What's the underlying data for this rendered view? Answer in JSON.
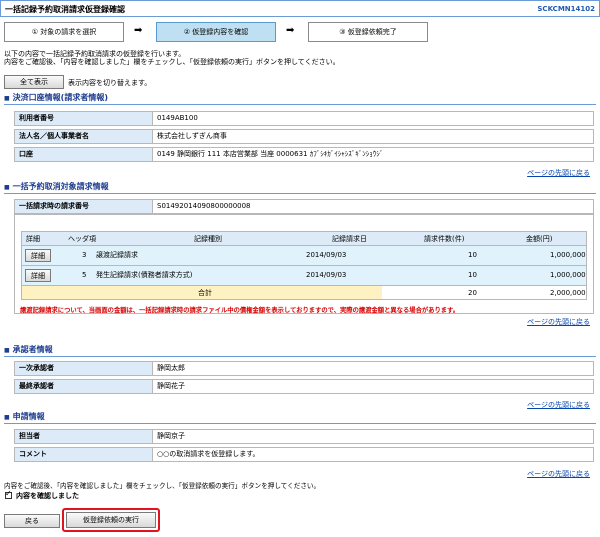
{
  "header": {
    "title": "一括記録予約取消請求仮登録確認",
    "screen_code": "SCKCMN14102"
  },
  "steps": [
    {
      "label": "① 対象の請求を選択"
    },
    {
      "label": "② 仮登録内容を確認"
    },
    {
      "label": "③ 仮登録依頼完了"
    }
  ],
  "intro": {
    "line1": "以下の内容で一括記録予約取消請求の仮登録を行います。",
    "line2": "内容をご確認後、「内容を確認しました」欄をチェックし、「仮登録依頼の実行」ボタンを押してください。"
  },
  "toggle": {
    "button": "全て表示",
    "text": "表示内容を切り替えます。"
  },
  "settlement": {
    "title": "決済口座情報(請求者情報)",
    "rows": [
      {
        "label": "利用者番号",
        "value": "0149AB100"
      },
      {
        "label": "法人名／個人事業者名",
        "value": "株式会社しずぎん商事"
      },
      {
        "label": "口座",
        "value": "0149 静岡銀行 111 本店営業部 当座 0000631 ｶﾌﾞｼｷｶﾞｲｼｬｼｽﾞｷﾞﾝｼｮｳｼﾞ"
      }
    ]
  },
  "page_top": "ページの先頭に戻る",
  "cancel_info": {
    "title": "一括予約取消対象請求情報",
    "request_label": "一括請求時の請求番号",
    "request_value": "S01492014090800000008",
    "columns": [
      "詳細",
      "ヘッダ項",
      "記録種別",
      "記録請求日",
      "請求件数(件)",
      "金額(円)"
    ],
    "rows": [
      {
        "detail": "詳細",
        "header": "3",
        "type": "譲渡記録請求",
        "date": "2014/09/03",
        "count": "10",
        "amount": "1,000,000"
      },
      {
        "detail": "詳細",
        "header": "5",
        "type": "発生記録請求(債務者請求方式)",
        "date": "2014/09/03",
        "count": "10",
        "amount": "1,000,000"
      }
    ],
    "total_label": "合計",
    "total_count": "20",
    "total_amount": "2,000,000",
    "notice": "譲渡記録請求について、当画面の金額は、一括記録請求時の請求ファイル中の債権金額を表示しておりますので、実際の譲渡金額と異なる場合があります。"
  },
  "approvers": {
    "title": "承認者情報",
    "rows": [
      {
        "label": "一次承認者",
        "value": "静岡太郎"
      },
      {
        "label": "最終承認者",
        "value": "静岡花子"
      }
    ]
  },
  "application": {
    "title": "申請情報",
    "rows": [
      {
        "label": "担当者",
        "value": "静岡京子"
      },
      {
        "label": "コメント",
        "value": "○○の取消請求を仮登録します。"
      }
    ]
  },
  "footer": {
    "note": "内容をご確認後、「内容を確認しました」欄をチェックし、「仮登録依頼の実行」ボタンを押してください。",
    "check_label": "内容を確認しました",
    "back": "戻る",
    "execute": "仮登録依頼の実行"
  },
  "colors": {
    "accent": "#1d3d8f",
    "highlight": "#e0141e",
    "active_step": "#bfe0f2"
  }
}
